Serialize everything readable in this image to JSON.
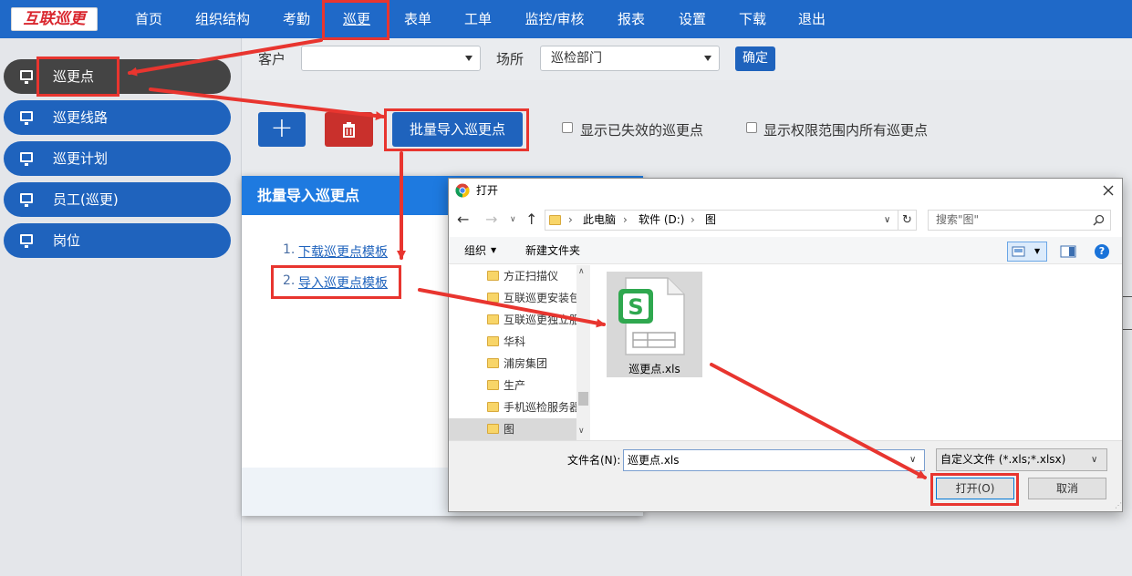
{
  "brand": {
    "logo_text": "互联巡更"
  },
  "nav": {
    "items": [
      "首页",
      "组织结构",
      "考勤",
      "巡更",
      "表单",
      "工单",
      "监控/审核",
      "报表",
      "设置",
      "下载",
      "退出"
    ],
    "active_index": 3
  },
  "sidebar": {
    "items": [
      "巡更点",
      "巡更线路",
      "巡更计划",
      "员工(巡更)",
      "岗位"
    ],
    "active_index": 0
  },
  "filter": {
    "customer_label": "客户",
    "customer_value": "",
    "site_label": "场所",
    "site_value": "巡检部门",
    "confirm_label": "确定"
  },
  "toolbar": {
    "add_glyph": "+",
    "import_label": "批量导入巡更点",
    "show_invalid_label": "显示已失效的巡更点",
    "show_all_label": "显示权限范围内所有巡更点"
  },
  "import_panel": {
    "title": "批量导入巡更点",
    "step1_num": "1.",
    "step1_link": "下载巡更点模板",
    "step2_num": "2.",
    "step2_link": "导入巡更点模板"
  },
  "file_dialog": {
    "title": "打开",
    "path": [
      "此电脑",
      "软件 (D:)",
      "图"
    ],
    "search_placeholder": "搜索\"图\"",
    "organize_label": "组织",
    "new_folder_label": "新建文件夹",
    "tree": [
      "方正扫描仪",
      "互联巡更安装包",
      "互联巡更独立服",
      "华科",
      "浦房集团",
      "生产",
      "手机巡检服务器",
      "图"
    ],
    "selected_tree_index": 7,
    "file_name": "巡更点.xls",
    "filename_label": "文件名(N):",
    "filename_value": "巡更点.xls",
    "filetype_value": "自定义文件 (*.xls;*.xlsx)",
    "open_label": "打开(O)",
    "cancel_label": "取消",
    "help_glyph": "?"
  },
  "colors": {
    "nav_bg": "#1f69c8",
    "sidebar_item": "#1f63bd",
    "sidebar_active": "#444444",
    "delete_button": "#c9302c",
    "panel_header": "#1e7ae0",
    "annotation": "#e8352f",
    "excel_green": "#2fa84f"
  }
}
